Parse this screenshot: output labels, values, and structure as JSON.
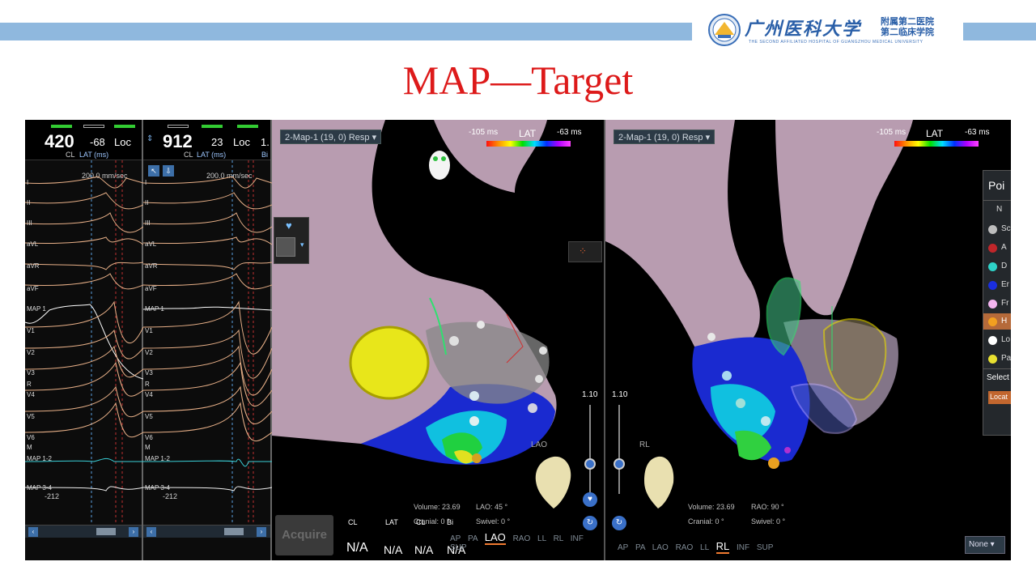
{
  "header": {
    "logo_name": "广州医科大学",
    "logo_sub_line1": "附属第二医院",
    "logo_sub_line2": "第二临床学院",
    "logo_english": "THE SECOND AFFILIATED HOSPITAL OF GUANGZHOU MEDICAL UNIVERSITY",
    "slide_title": "MAP—Target"
  },
  "ecg_panel_1": {
    "cl": "420",
    "lat": "-68",
    "loc": "Loc",
    "cl_label": "CL",
    "lat_label": "LAT (ms)",
    "speed": "200.0 mm/sec",
    "leads": [
      "I",
      "II",
      "III",
      "aVL",
      "aVR",
      "aVF",
      "MAP 1",
      "V1",
      "V2",
      "V3",
      "R",
      "V4",
      "V5",
      "V6",
      "M",
      "MAP 1-2",
      "MAP 3-4"
    ],
    "bottom_value": "-212"
  },
  "ecg_panel_2": {
    "cl": "912",
    "lat": "23",
    "loc": "Loc",
    "extra": "1.",
    "cl_label": "CL",
    "lat_label": "LAT (ms)",
    "bi_label": "Bi",
    "speed": "200.0 mm/sec",
    "leads": [
      "I",
      "II",
      "III",
      "aVL",
      "aVR",
      "aVF",
      "MAP 1",
      "V1",
      "V2",
      "V3",
      "R",
      "V4",
      "V5",
      "V6",
      "M",
      "MAP 1-2",
      "MAP 3-4"
    ],
    "bottom_value": "-212"
  },
  "map_left": {
    "dropdown": "2-Map-1 (19, 0) Resp",
    "lat_title": "LAT",
    "lat_min": "-105 ms",
    "lat_max": "-63 ms",
    "zoom": "1.10",
    "orientation": "LAO",
    "volume_label": "Volume:",
    "volume": "23.69",
    "lao_label": "LAO:",
    "lao": "45 °",
    "cranial_label": "Cranial:",
    "cranial": "0 °",
    "swivel_label": "Swivel:",
    "swivel": "0 °",
    "acquire": "Acquire",
    "meas_headers": [
      "CL",
      "LAT",
      "CL",
      "Bi"
    ],
    "meas_values": [
      "N/A",
      "N/A",
      "N/A",
      "N/A"
    ],
    "views": [
      "AP",
      "PA",
      "LAO",
      "RAO",
      "LL",
      "RL",
      "INF",
      "SUP"
    ],
    "active_view": "LAO"
  },
  "map_right": {
    "dropdown": "2-Map-1 (19, 0) Resp",
    "lat_title": "LAT",
    "lat_min": "-105 ms",
    "lat_max": "-63 ms",
    "zoom": "1.10",
    "orientation": "RL",
    "volume_label": "Volume:",
    "volume": "23.69",
    "rao_label": "RAO:",
    "rao": "90 °",
    "cranial_label": "Cranial:",
    "cranial": "0 °",
    "swivel_label": "Swivel:",
    "swivel": "0 °",
    "views": [
      "AP",
      "PA",
      "LAO",
      "RAO",
      "LL",
      "RL",
      "INF",
      "SUP"
    ],
    "active_view": "RL",
    "none_select": "None"
  },
  "points_panel": {
    "title": "Poi",
    "items": [
      {
        "label": "N",
        "color": "transparent"
      },
      {
        "label": "Sc",
        "color": "#bdbdbd"
      },
      {
        "label": "A",
        "color": "#c0262a"
      },
      {
        "label": "D",
        "color": "#2ed3c8"
      },
      {
        "label": "Er",
        "color": "#1a2ee0"
      },
      {
        "label": "Fr",
        "color": "#f4b4f0"
      },
      {
        "label": "H",
        "color": "#f2a020"
      },
      {
        "label": "Lo",
        "color": "#ffffff"
      },
      {
        "label": "Pa",
        "color": "#e8e030"
      }
    ],
    "select_label": "Select",
    "locate_button": "Locat"
  }
}
